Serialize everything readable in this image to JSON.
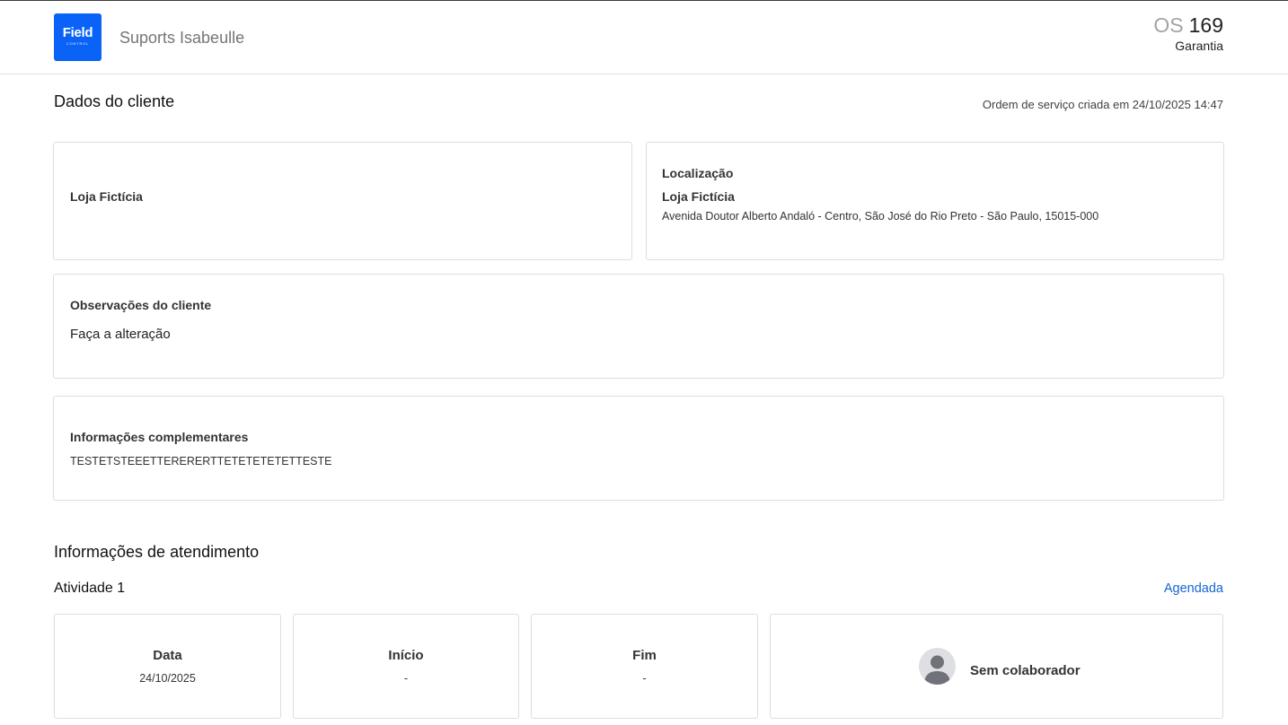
{
  "brand": {
    "logo_text": "Field",
    "logo_subtext": "CONTROL",
    "accent": "#0a63f6"
  },
  "header": {
    "company": "Suports Isabeulle",
    "os_prefix": "OS",
    "os_number": "169",
    "os_type": "Garantia"
  },
  "client_section": {
    "title": "Dados do cliente",
    "created_at": "Ordem de serviço criada em 24/10/2025 14:47",
    "client_name": "Loja Fictícia",
    "location": {
      "label": "Localização",
      "name": "Loja Fictícia",
      "address": "Avenida Doutor Alberto Andaló - Centro, São José do Rio Preto - São Paulo, 15015-000"
    },
    "observations": {
      "label": "Observações do cliente",
      "text": "Faça a alteração"
    },
    "complementary": {
      "label": "Informações complementares",
      "text": "TESTETSTEEETTERERERTTETETETETETTESTE"
    }
  },
  "service_section": {
    "title": "Informações de atendimento",
    "activity": {
      "title": "Atividade 1",
      "status": "Agendada",
      "status_color": "#1464d3",
      "date": {
        "label": "Data",
        "value": "24/10/2025"
      },
      "start": {
        "label": "Início",
        "value": "-"
      },
      "end": {
        "label": "Fim",
        "value": "-"
      },
      "collaborator": {
        "name": "Sem colaborador",
        "icon": "user-avatar-icon"
      }
    }
  }
}
